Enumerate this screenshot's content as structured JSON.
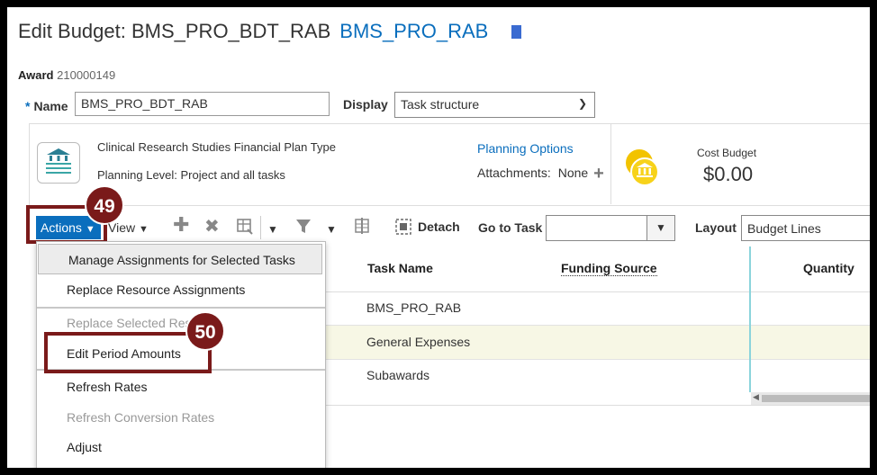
{
  "header": {
    "title": "Edit Budget: BMS_PRO_BDT_RAB",
    "project_link": "BMS_PRO_RAB"
  },
  "award": {
    "label": "Award",
    "value": "210000149"
  },
  "form": {
    "name_required": "*",
    "name_label": "Name",
    "name_value": "BMS_PRO_BDT_RAB",
    "display_label": "Display",
    "display_value": "Task structure"
  },
  "plan": {
    "plan_type": "Clinical Research Studies Financial Plan Type",
    "planning_level": "Planning Level: Project and all tasks",
    "planning_options": "Planning Options",
    "attachments_label": "Attachments:",
    "attachments_value": "None",
    "cost_budget_label": "Cost Budget",
    "cost_budget_value": "$0.00"
  },
  "toolbar": {
    "actions_label": "Actions",
    "view_label": "View",
    "detach_label": "Detach",
    "goto_label": "Go to Task",
    "goto_value": "",
    "layout_label": "Layout",
    "layout_value": "Budget Lines"
  },
  "callouts": {
    "step1": "49",
    "step2": "50"
  },
  "table": {
    "columns": [
      "Task Name",
      "Funding Source",
      "Quantity"
    ],
    "rows": [
      {
        "task": "BMS_PRO_RAB"
      },
      {
        "task": "General Expenses"
      },
      {
        "task": "Subawards"
      }
    ]
  },
  "actions_menu": {
    "items": [
      {
        "label": "Manage Assignments for Selected Tasks",
        "enabled": true
      },
      {
        "label": "Replace Resource Assignments",
        "enabled": true
      },
      {
        "label": "Replace Selected Res",
        "enabled": false
      },
      {
        "label": "Edit Period Amounts",
        "enabled": true
      },
      {
        "label": "Refresh Rates",
        "enabled": true
      },
      {
        "label": "Refresh Conversion Rates",
        "enabled": false
      },
      {
        "label": "Adjust",
        "enabled": true
      }
    ]
  },
  "colors": {
    "accent": "#0a6ebd",
    "callout": "#7a1a1a",
    "row_highlight": "#f7f7e5"
  }
}
